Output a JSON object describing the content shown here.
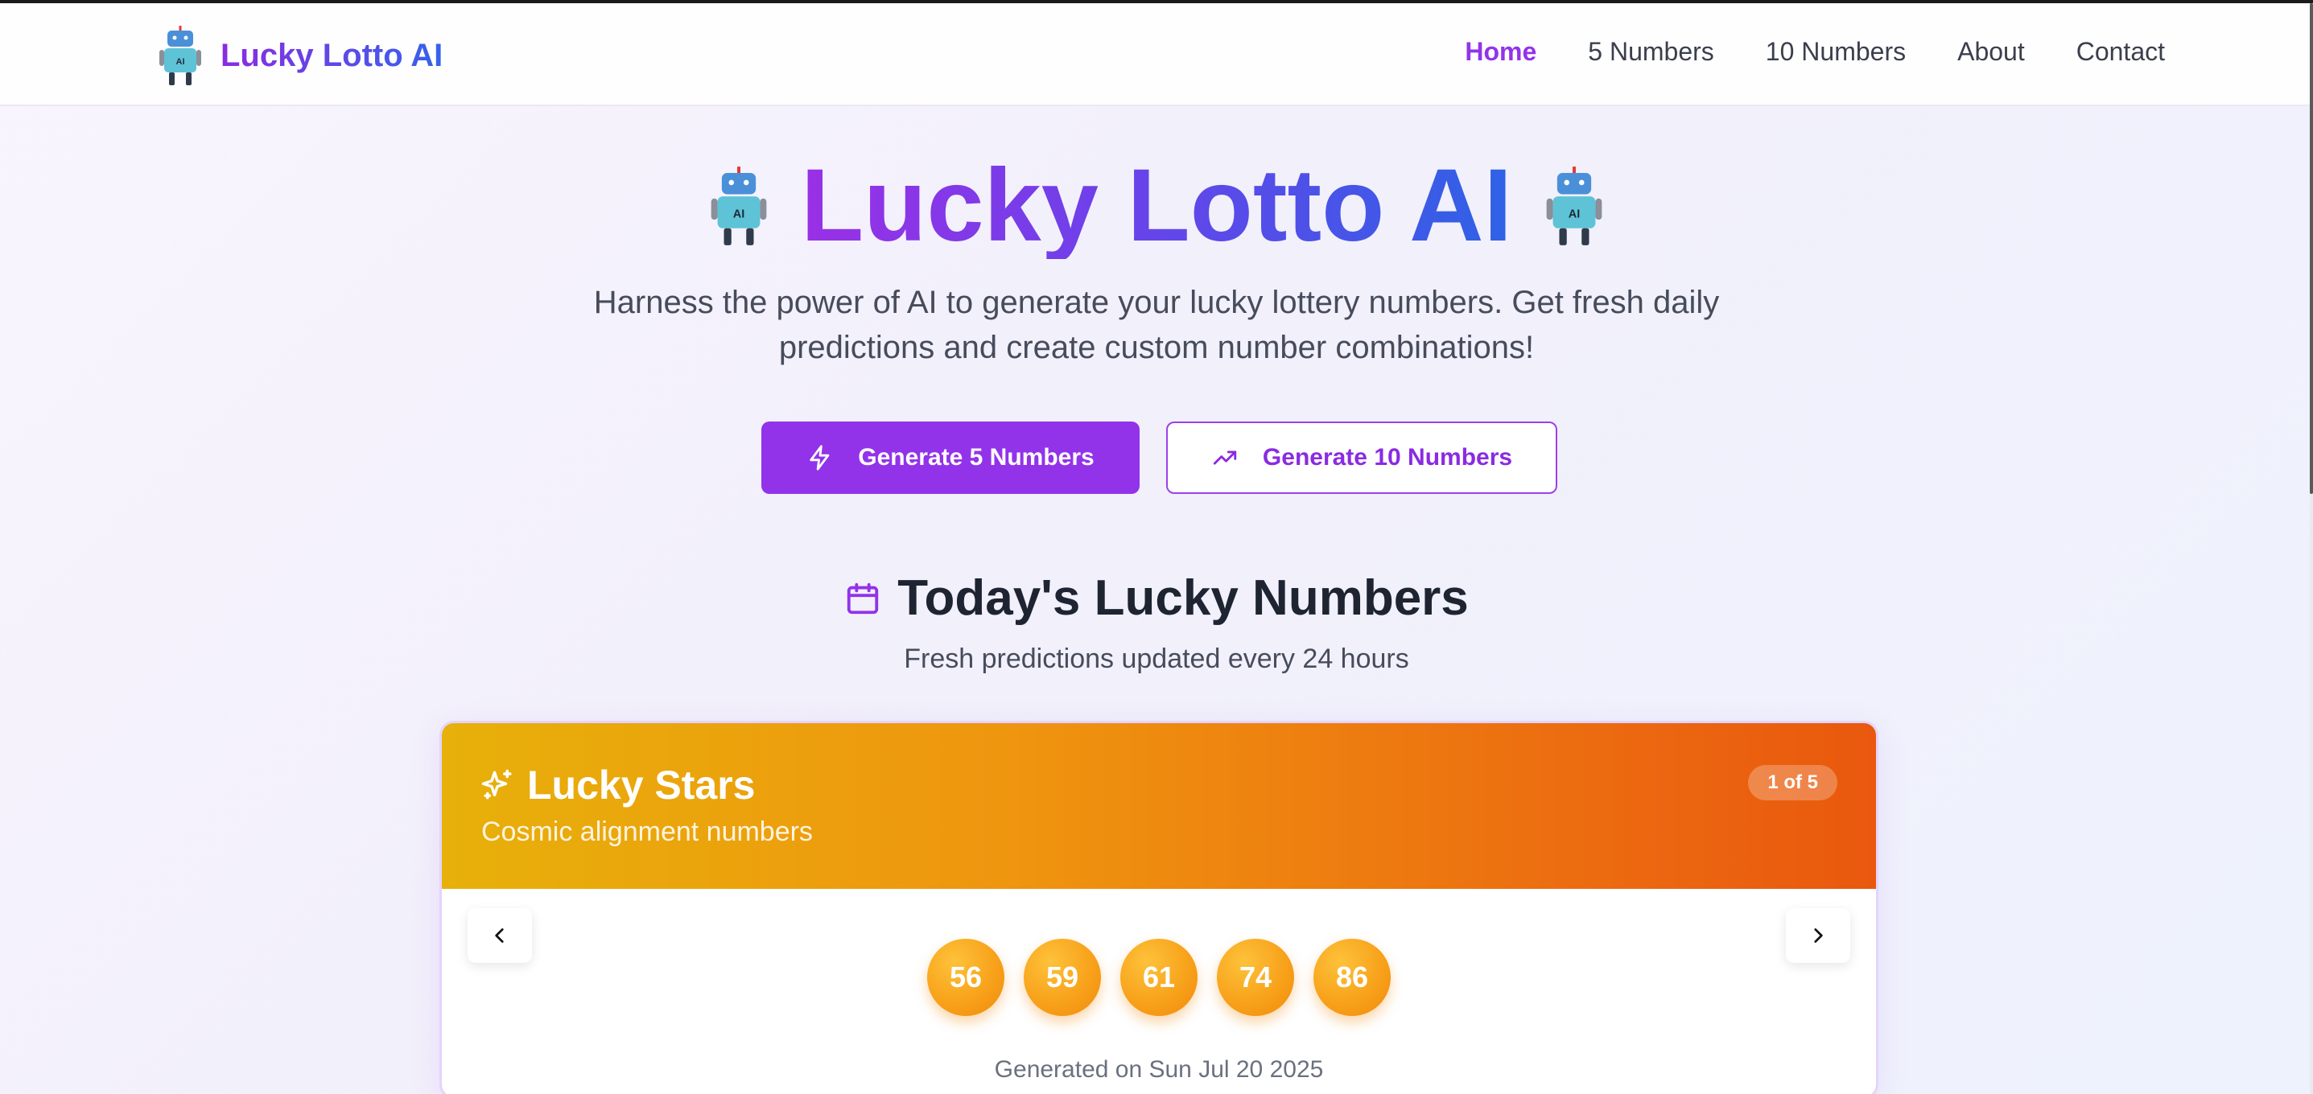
{
  "nav": {
    "brand": "Lucky Lotto AI",
    "items": [
      {
        "label": "Home",
        "active": true
      },
      {
        "label": "5 Numbers",
        "active": false
      },
      {
        "label": "10 Numbers",
        "active": false
      },
      {
        "label": "About",
        "active": false
      },
      {
        "label": "Contact",
        "active": false
      }
    ]
  },
  "hero": {
    "title": "Lucky Lotto AI",
    "robot_text": "AI",
    "subtitle": "Harness the power of AI to generate your lucky lottery numbers. Get fresh daily predictions and create custom number combinations!",
    "primary_button": "Generate 5 Numbers",
    "secondary_button": "Generate 10 Numbers"
  },
  "today": {
    "title": "Today's Lucky Numbers",
    "subtitle": "Fresh predictions updated every 24 hours"
  },
  "card": {
    "title": "Lucky Stars",
    "description": "Cosmic alignment numbers",
    "badge": "1 of 5",
    "numbers": [
      "56",
      "59",
      "61",
      "74",
      "86"
    ],
    "generated": "Generated on Sun Jul 20 2025"
  },
  "colors": {
    "accent": "#9233ea",
    "blue": "#2e62e6",
    "card_gradient_start": "#e7b00a",
    "card_gradient_end": "#e9580e",
    "ball": "#f8a21b"
  },
  "icons": {
    "brand": "robot-icon",
    "primary_button": "lightning-icon",
    "secondary_button": "trending-up-icon",
    "today": "calendar-icon",
    "card": "sparkles-icon",
    "prev": "chevron-left-icon",
    "next": "chevron-right-icon"
  }
}
